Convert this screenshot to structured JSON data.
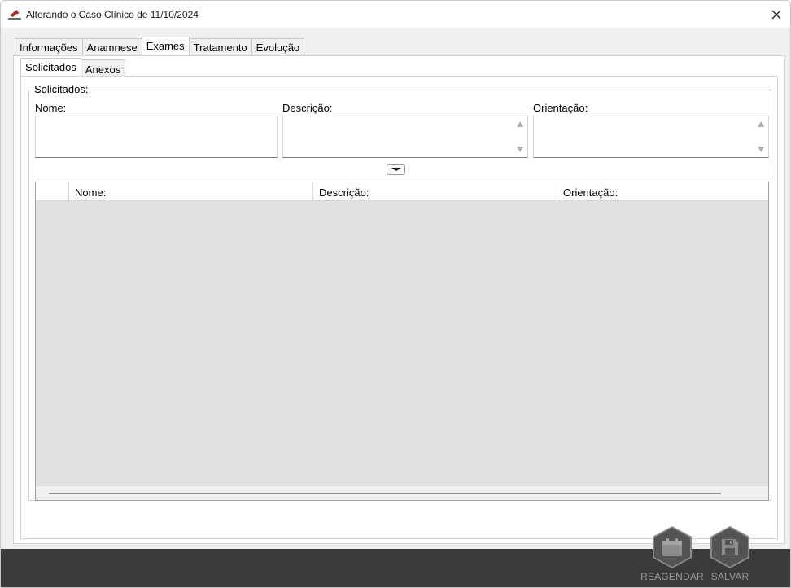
{
  "window": {
    "title": "Alterando o Caso Clínico de 11/10/2024"
  },
  "tabs": [
    "Informações",
    "Anamnese",
    "Exames",
    "Tratamento",
    "Evolução"
  ],
  "active_tab": "Exames",
  "subtabs": [
    "Solicitados",
    "Anexos"
  ],
  "active_subtab": "Solicitados",
  "group": {
    "label": "Solicitados:",
    "fields": {
      "nome_label": "Nome:",
      "nome_value": "",
      "descricao_label": "Descrição:",
      "descricao_value": "",
      "orientacao_label": "Orientação:",
      "orientacao_value": ""
    }
  },
  "grid": {
    "columns": [
      "",
      "Nome:",
      "Descrição:",
      "Orientação:"
    ],
    "rows": []
  },
  "actions": {
    "reschedule_label": "REAGENDAR",
    "save_label": "SALVAR"
  },
  "colors": {
    "footer": "#3b3b3b",
    "grid_bg": "#e1e1e1",
    "action_text": "#9a9a9a"
  }
}
